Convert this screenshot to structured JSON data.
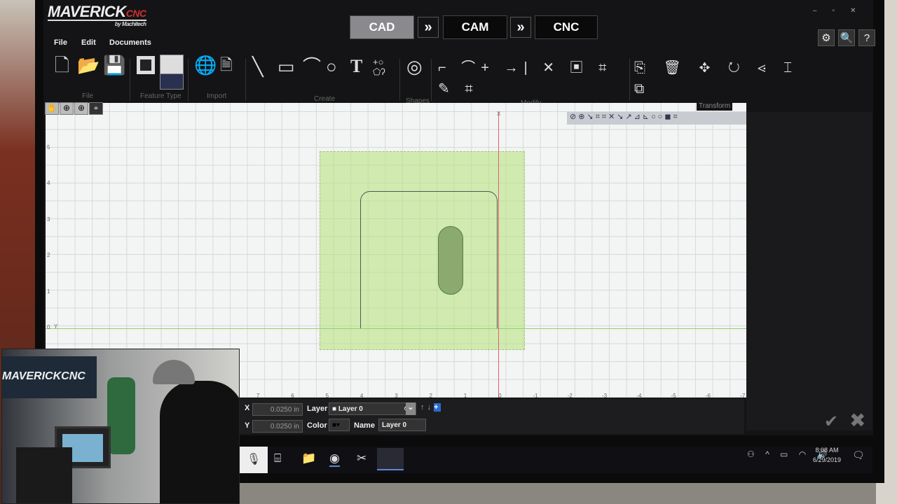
{
  "app": {
    "logo": "MAVERICK",
    "logo_suffix": "CNC",
    "logo_by": "by Machitech"
  },
  "modes": [
    "CAD",
    "CAM",
    "CNC"
  ],
  "menu": [
    "File",
    "Edit",
    "Documents"
  ],
  "groups": [
    "File",
    "Feature Type",
    "Import",
    "Create",
    "Shapes",
    "Modify",
    "Transform"
  ],
  "ruler": {
    "y": [
      "5",
      "4",
      "3",
      "2",
      "1",
      "0"
    ],
    "x": [
      "7",
      "6",
      "5",
      "4",
      "3",
      "2",
      "1",
      "0",
      "-1",
      "-2",
      "-3",
      "-4",
      "-5",
      "-6",
      "-7"
    ],
    "x_axis": "X",
    "y_axis": "Y"
  },
  "props": {
    "x_label": "X",
    "x_value": "0.0250 in",
    "y_label": "Y",
    "y_value": "0.0250 in",
    "layer_label": "Layer",
    "layer_value": "Layer 0",
    "color_label": "Color",
    "name_label": "Name",
    "name_value": "Layer 0"
  },
  "taskbar": {
    "time": "8:08 AM",
    "date": "6/29/2019"
  },
  "pip": {
    "banner": "MAVERICKCNC"
  }
}
